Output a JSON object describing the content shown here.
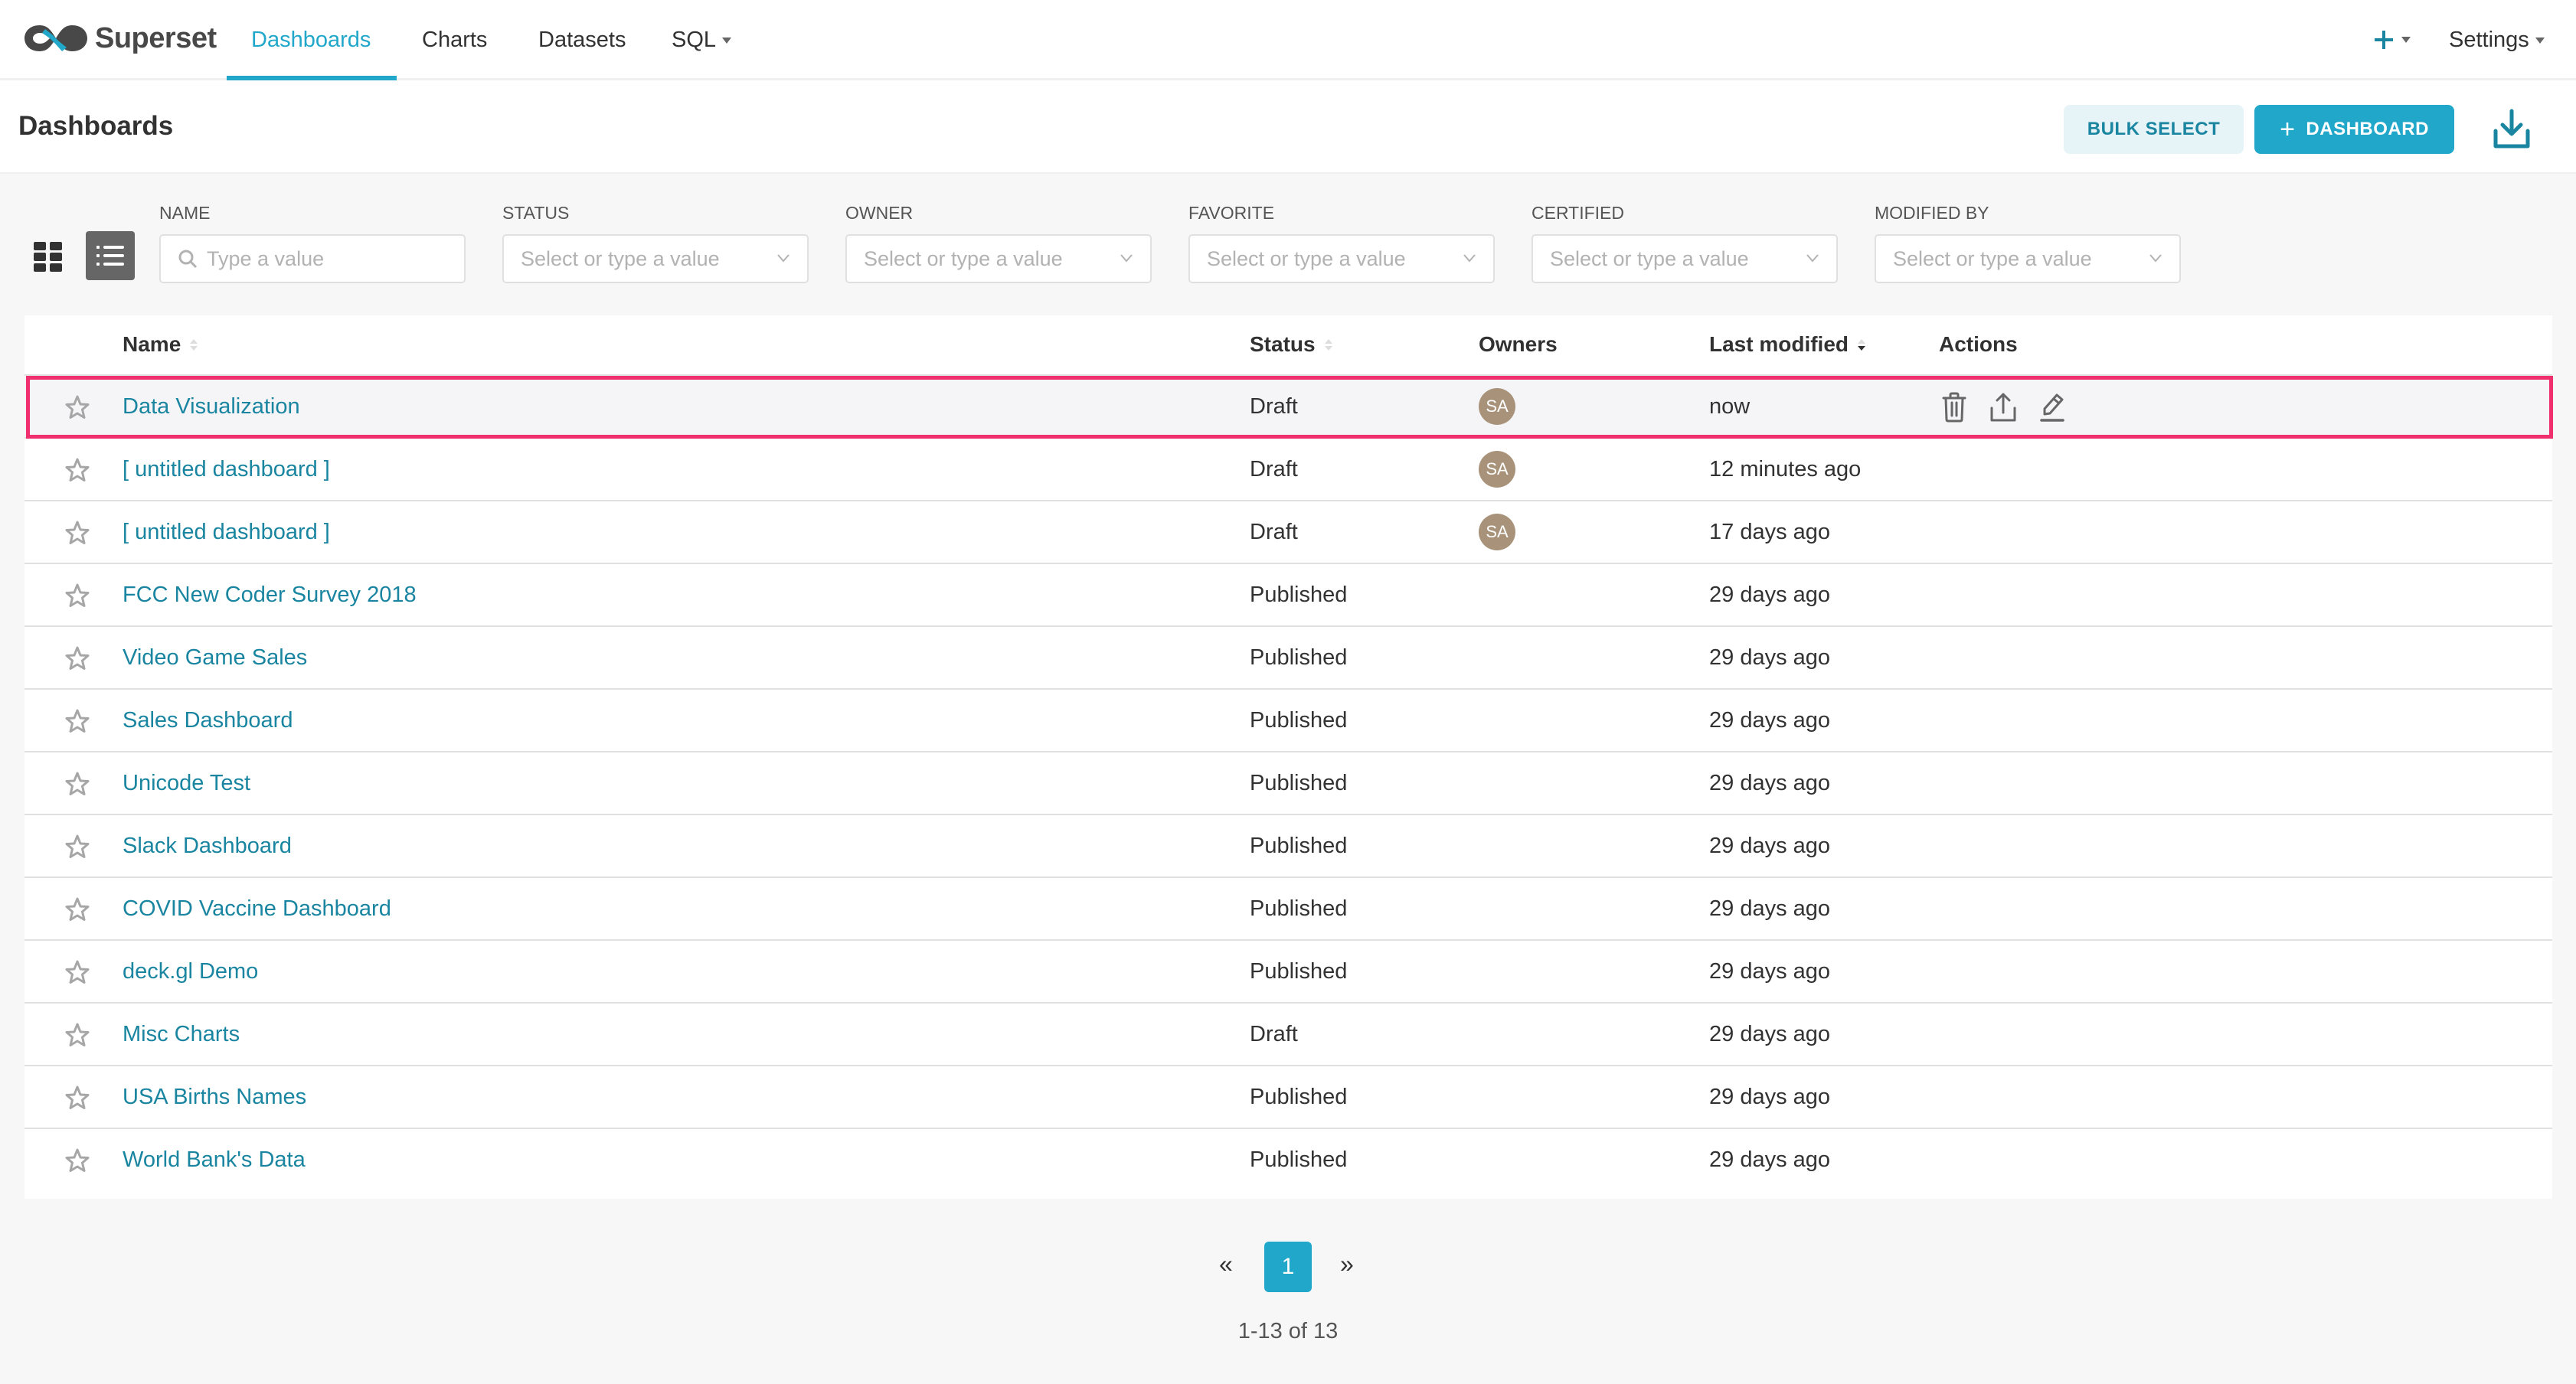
{
  "app": {
    "name": "Superset",
    "brand_color": "#20a7c9",
    "link_color": "#1a85a0",
    "highlight_color": "#f0306e"
  },
  "nav": {
    "items": [
      {
        "label": "Dashboards",
        "active": true
      },
      {
        "label": "Charts"
      },
      {
        "label": "Datasets"
      },
      {
        "label": "SQL",
        "has_dropdown": true
      }
    ],
    "plus_icon": "plus-icon",
    "settings_label": "Settings"
  },
  "header": {
    "title": "Dashboards",
    "bulk_select_label": "BULK SELECT",
    "add_dashboard_label": "DASHBOARD",
    "import_icon": "download-icon"
  },
  "filters": [
    {
      "label": "NAME",
      "placeholder": "Type a value",
      "type": "search"
    },
    {
      "label": "STATUS",
      "placeholder": "Select or type a value",
      "type": "select"
    },
    {
      "label": "OWNER",
      "placeholder": "Select or type a value",
      "type": "select"
    },
    {
      "label": "FAVORITE",
      "placeholder": "Select or type a value",
      "type": "select"
    },
    {
      "label": "CERTIFIED",
      "placeholder": "Select or type a value",
      "type": "select"
    },
    {
      "label": "MODIFIED BY",
      "placeholder": "Select or type a value",
      "type": "select"
    }
  ],
  "view_mode": "list",
  "table": {
    "columns": [
      "Name",
      "Status",
      "Owners",
      "Last modified",
      "Actions"
    ],
    "sorted_by": "Last modified",
    "rows": [
      {
        "name": "Data Visualization",
        "status": "Draft",
        "owner": "SA",
        "modified": "now",
        "highlighted": true
      },
      {
        "name": "[ untitled dashboard ]",
        "status": "Draft",
        "owner": "SA",
        "modified": "12 minutes ago"
      },
      {
        "name": "[ untitled dashboard ]",
        "status": "Draft",
        "owner": "SA",
        "modified": "17 days ago"
      },
      {
        "name": "FCC New Coder Survey 2018",
        "status": "Published",
        "owner": "",
        "modified": "29 days ago"
      },
      {
        "name": "Video Game Sales",
        "status": "Published",
        "owner": "",
        "modified": "29 days ago"
      },
      {
        "name": "Sales Dashboard",
        "status": "Published",
        "owner": "",
        "modified": "29 days ago"
      },
      {
        "name": "Unicode Test",
        "status": "Published",
        "owner": "",
        "modified": "29 days ago"
      },
      {
        "name": "Slack Dashboard",
        "status": "Published",
        "owner": "",
        "modified": "29 days ago"
      },
      {
        "name": "COVID Vaccine Dashboard",
        "status": "Published",
        "owner": "",
        "modified": "29 days ago"
      },
      {
        "name": "deck.gl Demo",
        "status": "Published",
        "owner": "",
        "modified": "29 days ago"
      },
      {
        "name": "Misc Charts",
        "status": "Draft",
        "owner": "",
        "modified": "29 days ago"
      },
      {
        "name": "USA Births Names",
        "status": "Published",
        "owner": "",
        "modified": "29 days ago"
      },
      {
        "name": "World Bank's Data",
        "status": "Published",
        "owner": "",
        "modified": "29 days ago"
      }
    ],
    "row_actions": [
      "delete",
      "export",
      "edit"
    ]
  },
  "pagination": {
    "prev": "«",
    "next": "»",
    "current_page": "1",
    "summary": "1-13 of 13"
  }
}
